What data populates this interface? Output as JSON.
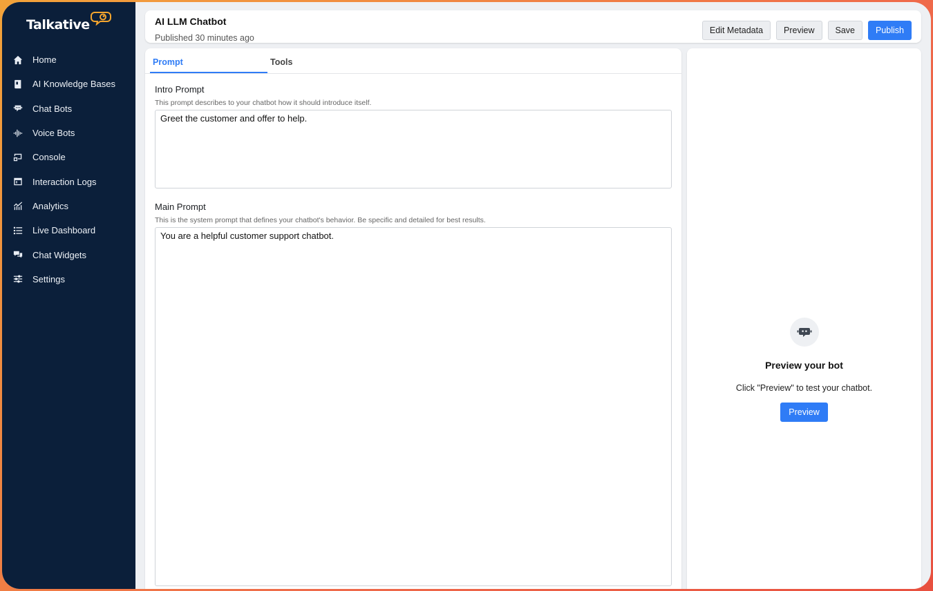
{
  "app": {
    "logo_text": "Talkative"
  },
  "sidebar": {
    "items": [
      {
        "label": "Home",
        "icon": "home-icon"
      },
      {
        "label": "AI Knowledge Bases",
        "icon": "book-icon"
      },
      {
        "label": "Chat Bots",
        "icon": "chat-bot-icon"
      },
      {
        "label": "Voice Bots",
        "icon": "waveform-icon"
      },
      {
        "label": "Console",
        "icon": "console-icon"
      },
      {
        "label": "Interaction Logs",
        "icon": "logs-icon"
      },
      {
        "label": "Analytics",
        "icon": "analytics-icon"
      },
      {
        "label": "Live Dashboard",
        "icon": "list-icon"
      },
      {
        "label": "Chat Widgets",
        "icon": "chat-widgets-icon"
      },
      {
        "label": "Settings",
        "icon": "sliders-icon"
      }
    ]
  },
  "header": {
    "title": "AI LLM Chatbot",
    "subtitle": "Published 30 minutes ago",
    "actions": {
      "edit_metadata": "Edit Metadata",
      "preview": "Preview",
      "save": "Save",
      "publish": "Publish"
    }
  },
  "tabs": [
    {
      "label": "Prompt",
      "active": true
    },
    {
      "label": "Tools",
      "active": false
    }
  ],
  "intro_prompt": {
    "label": "Intro Prompt",
    "help": "This prompt describes to your chatbot how it should introduce itself.",
    "value": "Greet the customer and offer to help."
  },
  "main_prompt": {
    "label": "Main Prompt",
    "help": "This is the system prompt that defines your chatbot's behavior. Be specific and detailed for best results.",
    "value": "You are a helpful customer support chatbot."
  },
  "preview_panel": {
    "title": "Preview your bot",
    "text": "Click \"Preview\" to test your chatbot.",
    "button": "Preview"
  },
  "colors": {
    "sidebar_bg": "#0b1f3a",
    "accent": "#2f7cf6",
    "logo_accent": "#f4a52e"
  }
}
